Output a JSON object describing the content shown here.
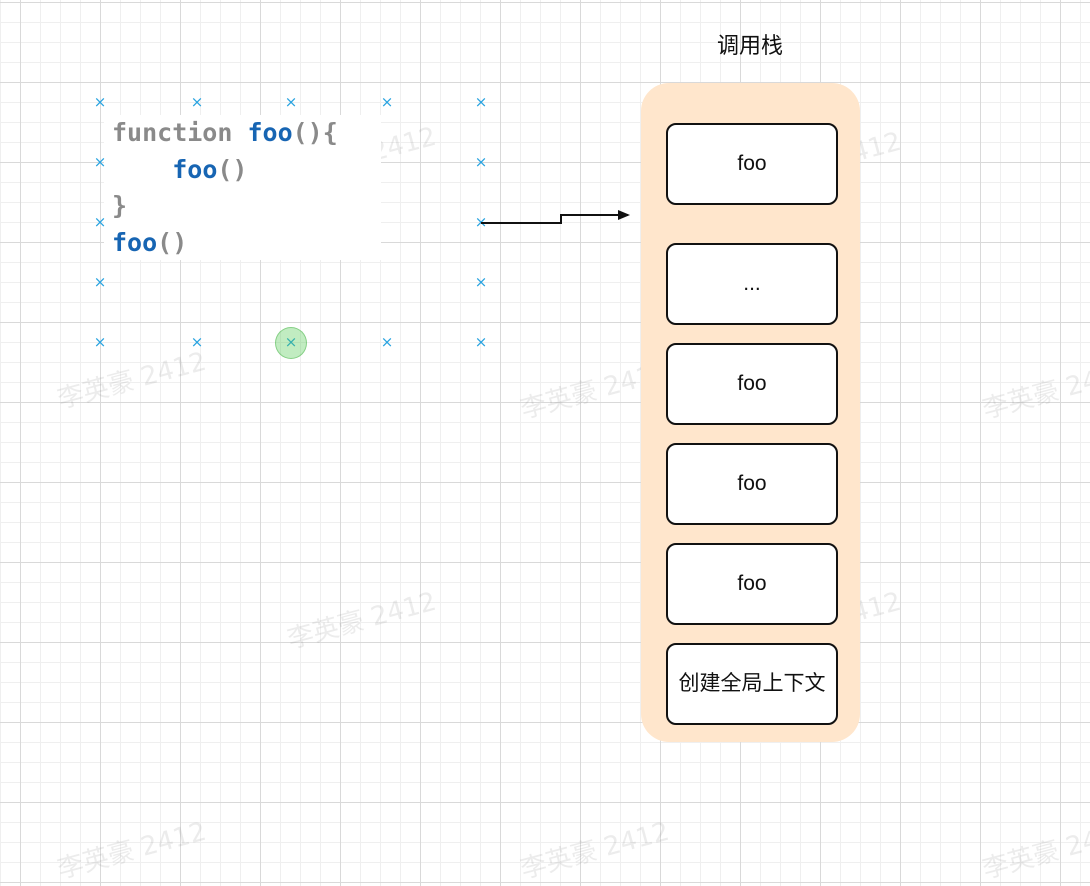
{
  "code": {
    "lines": [
      [
        {
          "t": "function ",
          "c": "kw"
        },
        {
          "t": "foo",
          "c": "fn"
        },
        {
          "t": "(){",
          "c": "pn"
        }
      ],
      [
        {
          "t": "    ",
          "c": "pn"
        },
        {
          "t": "foo",
          "c": "fn"
        },
        {
          "t": "()",
          "c": "pn"
        }
      ],
      [
        {
          "t": "}",
          "c": "pn"
        }
      ],
      [
        {
          "t": "foo",
          "c": "fn"
        },
        {
          "t": "()",
          "c": "pn"
        }
      ]
    ]
  },
  "stack": {
    "title": "调用栈",
    "frames": [
      {
        "label": "foo"
      },
      {
        "label": "..."
      },
      {
        "label": "foo"
      },
      {
        "label": "foo"
      },
      {
        "label": "foo"
      },
      {
        "label": "创建全局上下文"
      }
    ]
  },
  "watermark_text": "李英豪 2412",
  "colors": {
    "keyword": "#8a8a8a",
    "function_name": "#1765b3",
    "stack_background": "#ffe6cc",
    "handle": "#29a3e0",
    "selected_handle": "#4cc84c"
  }
}
